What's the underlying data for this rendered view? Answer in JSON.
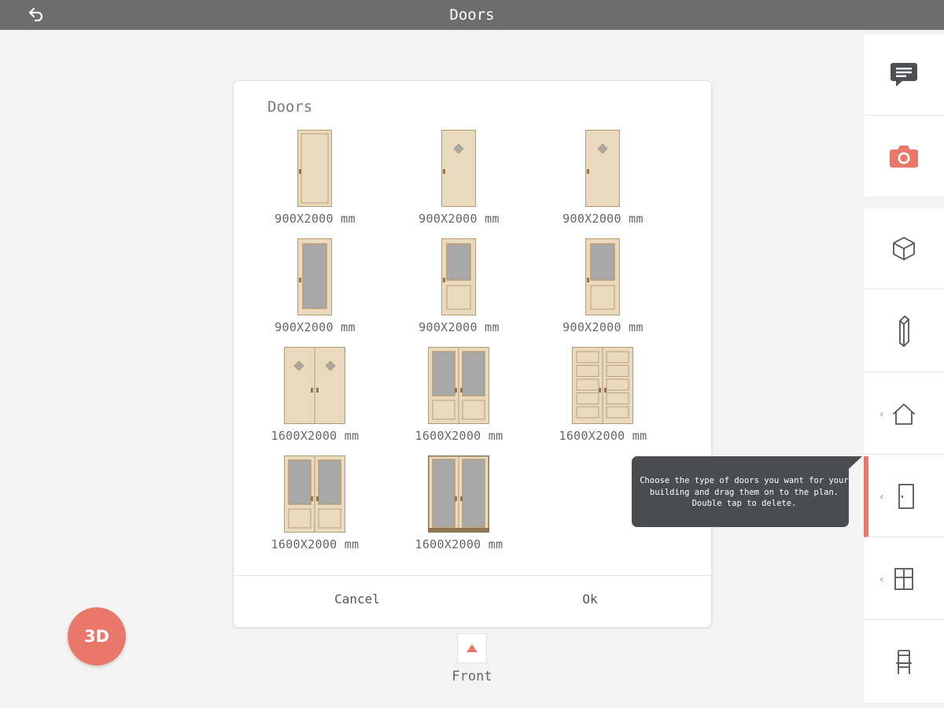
{
  "header": {
    "title": "Doors",
    "back_icon": "back-arrow-icon"
  },
  "dialog": {
    "title": "Doors",
    "items": [
      {
        "label": "900X2000 mm",
        "type": "single-solid"
      },
      {
        "label": "900X2000 mm",
        "type": "single-diamond"
      },
      {
        "label": "900X2000 mm",
        "type": "single-diamond"
      },
      {
        "label": "900X2000 mm",
        "type": "single-glass-full"
      },
      {
        "label": "900X2000 mm",
        "type": "single-glass-panel"
      },
      {
        "label": "900X2000 mm",
        "type": "single-glass-panel"
      },
      {
        "label": "1600X2000 mm",
        "type": "double-diamond"
      },
      {
        "label": "1600X2000 mm",
        "type": "double-glass-panel"
      },
      {
        "label": "1600X2000 mm",
        "type": "double-panels"
      },
      {
        "label": "1600X2000 mm",
        "type": "double-glass-panel"
      },
      {
        "label": "1600X2000 mm",
        "type": "double-glass-full"
      }
    ],
    "cancel_label": "Cancel",
    "ok_label": "Ok"
  },
  "view": {
    "front_label": "Front",
    "front_icon": "triangle-up-icon"
  },
  "fab": {
    "label": "3D"
  },
  "sidebar": {
    "top": [
      {
        "name": "chat",
        "icon": "chat-bubble-icon"
      },
      {
        "name": "camera",
        "icon": "camera-icon"
      }
    ],
    "tools": [
      {
        "name": "3d-object",
        "icon": "cube-icon",
        "chevron": false
      },
      {
        "name": "wall",
        "icon": "wall-icon",
        "chevron": false
      },
      {
        "name": "house",
        "icon": "house-icon",
        "chevron": true
      },
      {
        "name": "doors",
        "icon": "door-icon",
        "chevron": true,
        "active": true
      },
      {
        "name": "windows",
        "icon": "window-icon",
        "chevron": true
      },
      {
        "name": "furniture",
        "icon": "chair-icon",
        "chevron": false
      }
    ],
    "chevron_glyph": "‹"
  },
  "tooltip": {
    "text": "Choose the type of doors you want for your building and drag them on to the plan. Double tap to delete."
  },
  "colors": {
    "accent": "#e9776a",
    "topbar": "#6d6d6d",
    "wood": "#e9d9bd",
    "glass": "#a8a8a8",
    "tooltip": "#4a4c50"
  }
}
